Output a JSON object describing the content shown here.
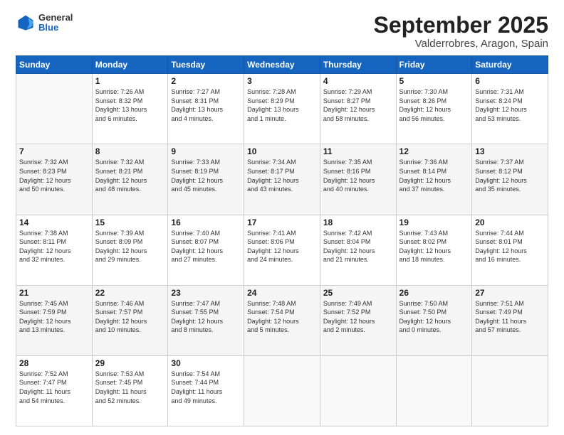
{
  "header": {
    "logo": {
      "general": "General",
      "blue": "Blue"
    },
    "title": "September 2025",
    "location": "Valderrobres, Aragon, Spain"
  },
  "weekdays": [
    "Sunday",
    "Monday",
    "Tuesday",
    "Wednesday",
    "Thursday",
    "Friday",
    "Saturday"
  ],
  "weeks": [
    [
      {
        "day": "",
        "info": ""
      },
      {
        "day": "1",
        "info": "Sunrise: 7:26 AM\nSunset: 8:32 PM\nDaylight: 13 hours\nand 6 minutes."
      },
      {
        "day": "2",
        "info": "Sunrise: 7:27 AM\nSunset: 8:31 PM\nDaylight: 13 hours\nand 4 minutes."
      },
      {
        "day": "3",
        "info": "Sunrise: 7:28 AM\nSunset: 8:29 PM\nDaylight: 13 hours\nand 1 minute."
      },
      {
        "day": "4",
        "info": "Sunrise: 7:29 AM\nSunset: 8:27 PM\nDaylight: 12 hours\nand 58 minutes."
      },
      {
        "day": "5",
        "info": "Sunrise: 7:30 AM\nSunset: 8:26 PM\nDaylight: 12 hours\nand 56 minutes."
      },
      {
        "day": "6",
        "info": "Sunrise: 7:31 AM\nSunset: 8:24 PM\nDaylight: 12 hours\nand 53 minutes."
      }
    ],
    [
      {
        "day": "7",
        "info": "Sunrise: 7:32 AM\nSunset: 8:23 PM\nDaylight: 12 hours\nand 50 minutes."
      },
      {
        "day": "8",
        "info": "Sunrise: 7:32 AM\nSunset: 8:21 PM\nDaylight: 12 hours\nand 48 minutes."
      },
      {
        "day": "9",
        "info": "Sunrise: 7:33 AM\nSunset: 8:19 PM\nDaylight: 12 hours\nand 45 minutes."
      },
      {
        "day": "10",
        "info": "Sunrise: 7:34 AM\nSunset: 8:17 PM\nDaylight: 12 hours\nand 43 minutes."
      },
      {
        "day": "11",
        "info": "Sunrise: 7:35 AM\nSunset: 8:16 PM\nDaylight: 12 hours\nand 40 minutes."
      },
      {
        "day": "12",
        "info": "Sunrise: 7:36 AM\nSunset: 8:14 PM\nDaylight: 12 hours\nand 37 minutes."
      },
      {
        "day": "13",
        "info": "Sunrise: 7:37 AM\nSunset: 8:12 PM\nDaylight: 12 hours\nand 35 minutes."
      }
    ],
    [
      {
        "day": "14",
        "info": "Sunrise: 7:38 AM\nSunset: 8:11 PM\nDaylight: 12 hours\nand 32 minutes."
      },
      {
        "day": "15",
        "info": "Sunrise: 7:39 AM\nSunset: 8:09 PM\nDaylight: 12 hours\nand 29 minutes."
      },
      {
        "day": "16",
        "info": "Sunrise: 7:40 AM\nSunset: 8:07 PM\nDaylight: 12 hours\nand 27 minutes."
      },
      {
        "day": "17",
        "info": "Sunrise: 7:41 AM\nSunset: 8:06 PM\nDaylight: 12 hours\nand 24 minutes."
      },
      {
        "day": "18",
        "info": "Sunrise: 7:42 AM\nSunset: 8:04 PM\nDaylight: 12 hours\nand 21 minutes."
      },
      {
        "day": "19",
        "info": "Sunrise: 7:43 AM\nSunset: 8:02 PM\nDaylight: 12 hours\nand 18 minutes."
      },
      {
        "day": "20",
        "info": "Sunrise: 7:44 AM\nSunset: 8:01 PM\nDaylight: 12 hours\nand 16 minutes."
      }
    ],
    [
      {
        "day": "21",
        "info": "Sunrise: 7:45 AM\nSunset: 7:59 PM\nDaylight: 12 hours\nand 13 minutes."
      },
      {
        "day": "22",
        "info": "Sunrise: 7:46 AM\nSunset: 7:57 PM\nDaylight: 12 hours\nand 10 minutes."
      },
      {
        "day": "23",
        "info": "Sunrise: 7:47 AM\nSunset: 7:55 PM\nDaylight: 12 hours\nand 8 minutes."
      },
      {
        "day": "24",
        "info": "Sunrise: 7:48 AM\nSunset: 7:54 PM\nDaylight: 12 hours\nand 5 minutes."
      },
      {
        "day": "25",
        "info": "Sunrise: 7:49 AM\nSunset: 7:52 PM\nDaylight: 12 hours\nand 2 minutes."
      },
      {
        "day": "26",
        "info": "Sunrise: 7:50 AM\nSunset: 7:50 PM\nDaylight: 12 hours\nand 0 minutes."
      },
      {
        "day": "27",
        "info": "Sunrise: 7:51 AM\nSunset: 7:49 PM\nDaylight: 11 hours\nand 57 minutes."
      }
    ],
    [
      {
        "day": "28",
        "info": "Sunrise: 7:52 AM\nSunset: 7:47 PM\nDaylight: 11 hours\nand 54 minutes."
      },
      {
        "day": "29",
        "info": "Sunrise: 7:53 AM\nSunset: 7:45 PM\nDaylight: 11 hours\nand 52 minutes."
      },
      {
        "day": "30",
        "info": "Sunrise: 7:54 AM\nSunset: 7:44 PM\nDaylight: 11 hours\nand 49 minutes."
      },
      {
        "day": "",
        "info": ""
      },
      {
        "day": "",
        "info": ""
      },
      {
        "day": "",
        "info": ""
      },
      {
        "day": "",
        "info": ""
      }
    ]
  ]
}
